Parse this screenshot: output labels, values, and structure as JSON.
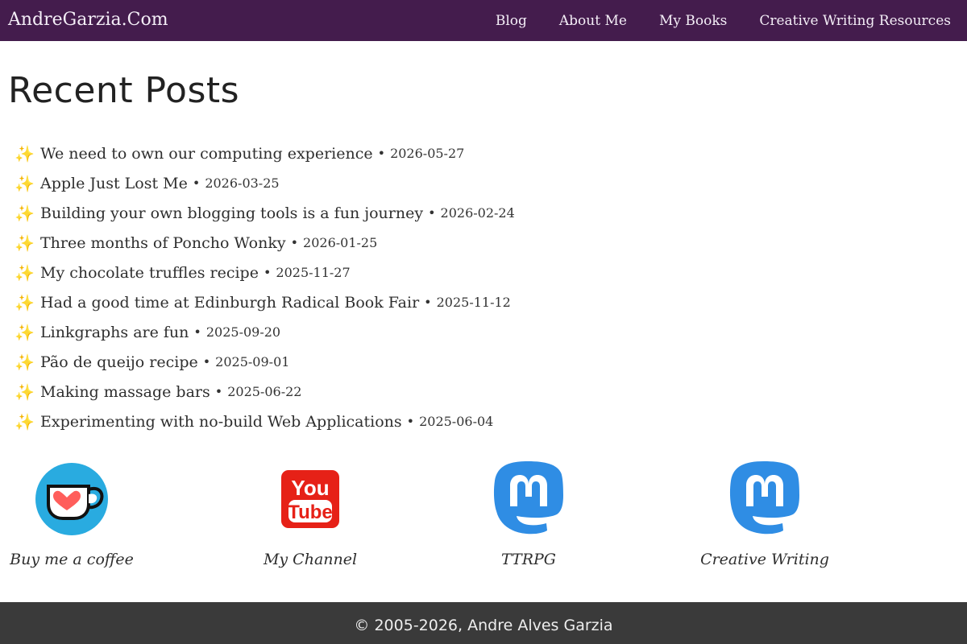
{
  "header": {
    "site_title": "AndreGarzia.Com",
    "nav": [
      {
        "label": "Blog"
      },
      {
        "label": "About Me"
      },
      {
        "label": "My Books"
      },
      {
        "label": "Creative Writing Resources"
      }
    ]
  },
  "main": {
    "heading": "Recent Posts",
    "bullet_icon": "sparkles-icon",
    "separator": "•",
    "posts": [
      {
        "title": "We need to own our computing experience",
        "date": "2026-05-27"
      },
      {
        "title": "Apple Just Lost Me",
        "date": "2026-03-25"
      },
      {
        "title": "Building your own blogging tools is a fun journey",
        "date": "2026-02-24"
      },
      {
        "title": "Three months of Poncho Wonky",
        "date": "2026-01-25"
      },
      {
        "title": "My chocolate truffles recipe",
        "date": "2025-11-27"
      },
      {
        "title": "Had a good time at Edinburgh Radical Book Fair",
        "date": "2025-11-12"
      },
      {
        "title": "Linkgraphs are fun",
        "date": "2025-09-20"
      },
      {
        "title": "Pão de queijo recipe",
        "date": "2025-09-01"
      },
      {
        "title": "Making massage bars",
        "date": "2025-06-22"
      },
      {
        "title": "Experimenting with no-build Web Applications",
        "date": "2025-06-04"
      }
    ]
  },
  "social": [
    {
      "label": "Buy me a coffee",
      "icon": "ko-fi-cup-icon"
    },
    {
      "label": "My Channel",
      "icon": "youtube-icon"
    },
    {
      "label": "TTRPG",
      "icon": "mastodon-icon"
    },
    {
      "label": "Creative Writing",
      "icon": "mastodon-icon"
    }
  ],
  "footer": {
    "copyright": "© 2005-2026, Andre Alves Garzia"
  },
  "colors": {
    "header_bg": "#441c4d",
    "footer_bg": "#3a3a3a",
    "kofi_blue": "#29abe0",
    "youtube_red": "#e62117",
    "mastodon_blue": "#2f8de4"
  }
}
